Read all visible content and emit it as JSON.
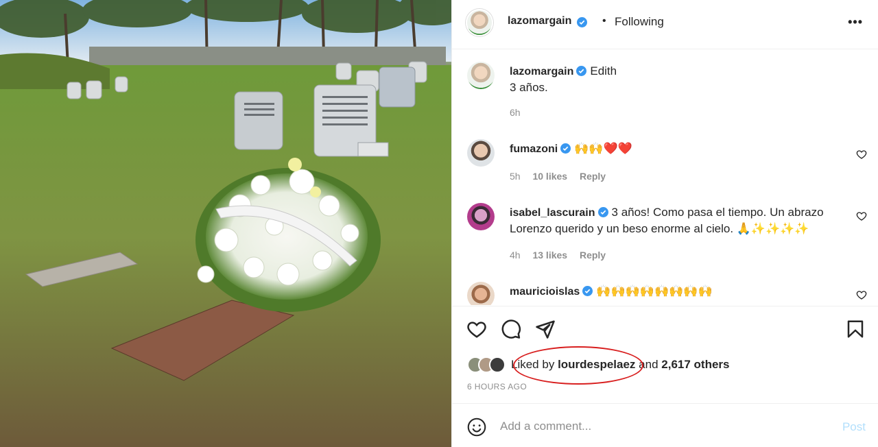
{
  "post_header": {
    "username": "lazomargain",
    "verified": true,
    "separator": "•",
    "follow_state": "Following",
    "more_icon": "more-horizontal-icon"
  },
  "caption": {
    "username": "lazomargain",
    "text_line1": "Edith",
    "text_line2": "3 años.",
    "time": "6h"
  },
  "comments": [
    {
      "username": "fumazoni",
      "text": "🙌🙌❤️❤️",
      "time": "5h",
      "likes": "10 likes",
      "reply": "Reply"
    },
    {
      "username": "isabel_lascurain",
      "text": "3 años! Como pasa el tiempo. Un abrazo Lorenzo querido y un beso enorme al cielo. 🙏✨✨✨✨",
      "time": "4h",
      "likes": "13 likes",
      "reply": "Reply"
    },
    {
      "username": "mauricioislas",
      "text": "🙌🙌🙌🙌🙌🙌🙌🙌",
      "time": "",
      "likes": "",
      "reply": ""
    }
  ],
  "likes_summary": {
    "prefix": "Liked by",
    "liker": "lourdespelaez",
    "suffix": "and",
    "others": "2,617 others"
  },
  "post_time": "6 HOURS AGO",
  "add_comment": {
    "placeholder": "Add a comment...",
    "post_label": "Post"
  },
  "colors": {
    "verified": "#3897f0",
    "post_disabled": "#b2dffc",
    "annotation_circle": "#d81e1e"
  }
}
